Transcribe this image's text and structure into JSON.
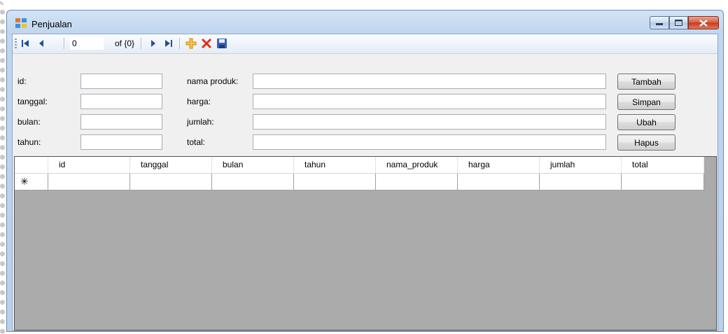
{
  "window": {
    "title": "Penjualan",
    "controls": {
      "minimize": "minimize",
      "maximize": "maximize",
      "close": "close"
    }
  },
  "navigator": {
    "position": "0",
    "count_label": "of {0}",
    "icons": [
      "move-first-icon",
      "move-previous-icon",
      "move-next-icon",
      "move-last-icon",
      "add-new-icon",
      "delete-icon",
      "save-icon"
    ]
  },
  "form": {
    "left": [
      {
        "label": "id:",
        "value": ""
      },
      {
        "label": "tanggal:",
        "value": ""
      },
      {
        "label": "bulan:",
        "value": ""
      },
      {
        "label": "tahun:",
        "value": ""
      }
    ],
    "right": [
      {
        "label": "nama produk:",
        "value": ""
      },
      {
        "label": "harga:",
        "value": ""
      },
      {
        "label": "jumlah:",
        "value": ""
      },
      {
        "label": "total:",
        "value": ""
      }
    ],
    "buttons": [
      "Tambah",
      "Simpan",
      "Ubah",
      "Hapus"
    ]
  },
  "grid": {
    "columns": [
      "id",
      "tanggal",
      "bulan",
      "tahun",
      "nama_produk",
      "harga",
      "jumlah",
      "total"
    ],
    "new_row_marker": "✳"
  },
  "colors": {
    "title_gradient": "#c1d7ef",
    "close_button": "#c7381f",
    "grid_background": "#ababab",
    "nav_arrow": "#1f4e9e"
  }
}
